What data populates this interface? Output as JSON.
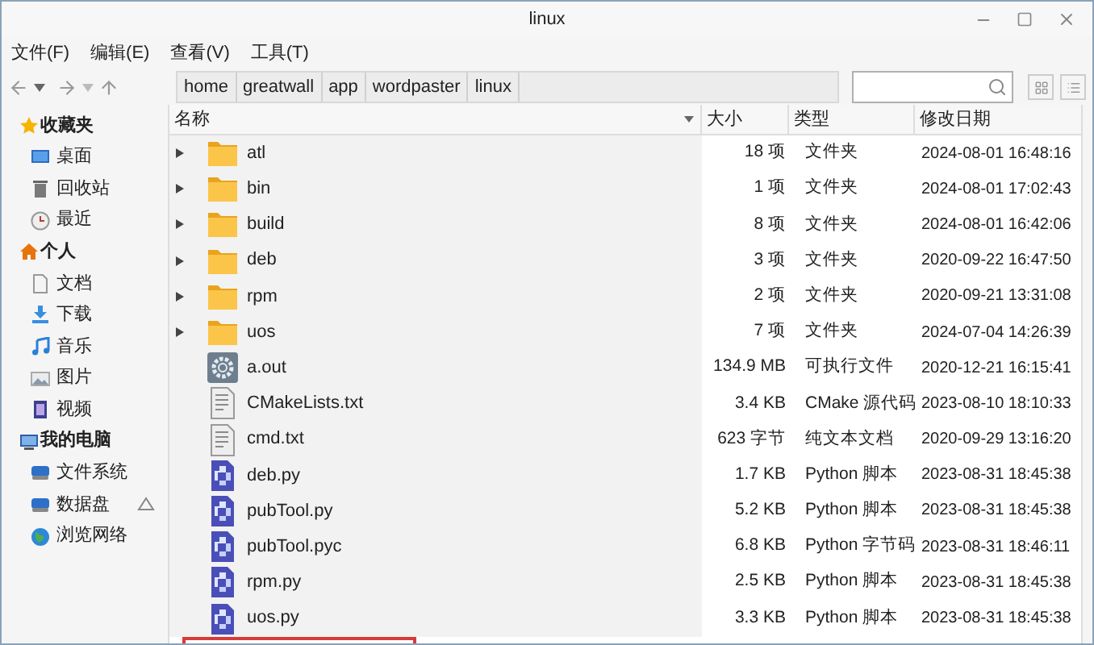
{
  "window": {
    "title": "linux"
  },
  "menu": [
    "文件(F)",
    "编辑(E)",
    "查看(V)",
    "工具(T)"
  ],
  "breadcrumb": [
    "home",
    "greatwall",
    "app",
    "wordpaster",
    "linux"
  ],
  "sidebar": {
    "sections": [
      {
        "title": "收藏夹",
        "kind": "star",
        "items": [
          {
            "label": "桌面",
            "kind": "desktop"
          },
          {
            "label": "回收站",
            "kind": "trash"
          },
          {
            "label": "最近",
            "kind": "recent"
          }
        ]
      },
      {
        "title": "个人",
        "kind": "home",
        "items": [
          {
            "label": "文档",
            "kind": "document"
          },
          {
            "label": "下载",
            "kind": "download"
          },
          {
            "label": "音乐",
            "kind": "music"
          },
          {
            "label": "图片",
            "kind": "image"
          },
          {
            "label": "视频",
            "kind": "video"
          }
        ]
      },
      {
        "title": "我的电脑",
        "kind": "computer",
        "items": [
          {
            "label": "文件系统",
            "kind": "drive"
          },
          {
            "label": "数据盘",
            "kind": "drive-eject"
          },
          {
            "label": "浏览网络",
            "kind": "network"
          }
        ]
      }
    ]
  },
  "table": {
    "columns": [
      "名称",
      "大小",
      "类型",
      "修改日期"
    ],
    "rows": [
      {
        "kind": "folder",
        "name": "atl",
        "size": "18 项",
        "type": "文件夹",
        "modified": "2024-08-01 16:48:16"
      },
      {
        "kind": "folder",
        "name": "bin",
        "size": "1 项",
        "type": "文件夹",
        "modified": "2024-08-01 17:02:43"
      },
      {
        "kind": "folder",
        "name": "build",
        "size": "8 项",
        "type": "文件夹",
        "modified": "2024-08-01 16:42:06"
      },
      {
        "kind": "folder",
        "name": "deb",
        "size": "3 项",
        "type": "文件夹",
        "modified": "2020-09-22 16:47:50"
      },
      {
        "kind": "folder",
        "name": "rpm",
        "size": "2 项",
        "type": "文件夹",
        "modified": "2020-09-21 13:31:08"
      },
      {
        "kind": "folder",
        "name": "uos",
        "size": "7 项",
        "type": "文件夹",
        "modified": "2024-07-04 14:26:39"
      },
      {
        "kind": "executable",
        "name": "a.out",
        "size": "134.9 MB",
        "type": "可执行文件",
        "modified": "2020-12-21 16:15:41"
      },
      {
        "kind": "text",
        "name": "CMakeLists.txt",
        "size": "3.4 KB",
        "type": "CMake 源代码",
        "modified": "2023-08-10 18:10:33"
      },
      {
        "kind": "text",
        "name": "cmd.txt",
        "size": "623 字节",
        "type": "纯文本文档",
        "modified": "2020-09-29 13:16:20"
      },
      {
        "kind": "python",
        "name": "deb.py",
        "size": "1.7 KB",
        "type": "Python 脚本",
        "modified": "2023-08-31 18:45:38"
      },
      {
        "kind": "python",
        "name": "pubTool.py",
        "size": "5.2 KB",
        "type": "Python 脚本",
        "modified": "2023-08-31 18:45:38"
      },
      {
        "kind": "python",
        "name": "pubTool.pyc",
        "size": "6.8 KB",
        "type": "Python 字节码",
        "modified": "2023-08-31 18:46:11"
      },
      {
        "kind": "python",
        "name": "rpm.py",
        "size": "2.5 KB",
        "type": "Python 脚本",
        "modified": "2023-08-31 18:45:38"
      },
      {
        "kind": "python",
        "name": "uos.py",
        "size": "3.3 KB",
        "type": "Python 脚本",
        "modified": "2023-08-31 18:45:38"
      }
    ]
  }
}
